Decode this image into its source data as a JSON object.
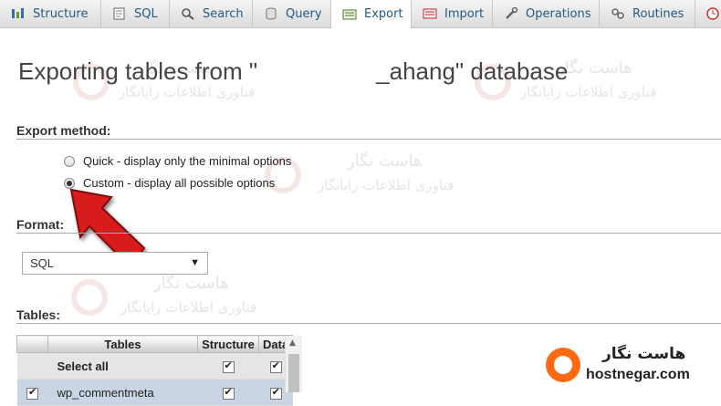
{
  "tabs": [
    {
      "label": "Structure",
      "icon": "structure-icon"
    },
    {
      "label": "SQL",
      "icon": "sql-icon"
    },
    {
      "label": "Search",
      "icon": "search-icon"
    },
    {
      "label": "Query",
      "icon": "query-icon"
    },
    {
      "label": "Export",
      "icon": "export-icon",
      "active": true
    },
    {
      "label": "Import",
      "icon": "import-icon"
    },
    {
      "label": "Operations",
      "icon": "wrench-icon"
    },
    {
      "label": "Routines",
      "icon": "routines-icon"
    },
    {
      "label": "",
      "icon": "clock-icon"
    }
  ],
  "page": {
    "title": "Exporting tables from \"                  _ahang\" database"
  },
  "export_method": {
    "heading": "Export method:",
    "options": [
      {
        "label": "Quick - display only the minimal options",
        "selected": false
      },
      {
        "label": "Custom - display all possible options",
        "selected": true
      }
    ]
  },
  "format": {
    "heading": "Format:",
    "selected": "SQL"
  },
  "tables": {
    "heading": "Tables:",
    "columns": [
      "Tables",
      "Structure",
      "Data"
    ],
    "select_all": "Select all",
    "rows": [
      {
        "name": "wp_commentmeta",
        "checked": true
      }
    ]
  },
  "watermark": {
    "line1": "هاست نگار",
    "line2": "فناوری اطلاعات رایانگار"
  },
  "logo": {
    "fa": "هاست نگار",
    "en": "hostnegar.com"
  },
  "colors": {
    "tab_text": "#235a81",
    "arrow": "#d81c1c",
    "logo_orange": "#ff6a13"
  }
}
